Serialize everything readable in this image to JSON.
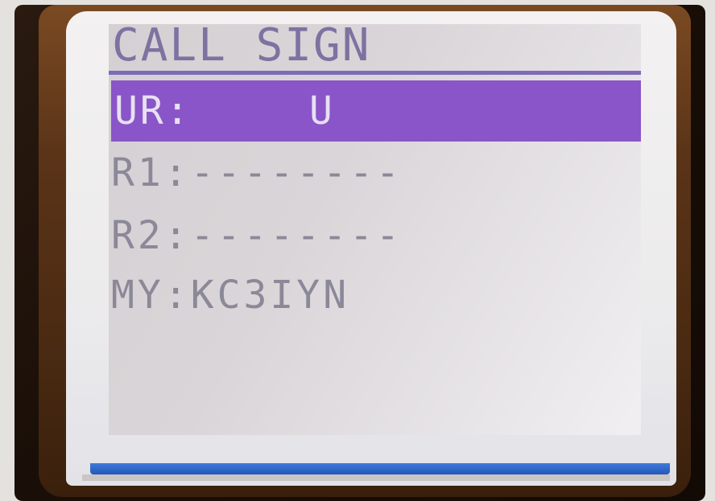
{
  "screen": {
    "title": "CALL SIGN",
    "rows": [
      {
        "label": "UR:",
        "value": "U",
        "selected": true
      },
      {
        "label": "R1:",
        "value": "--------",
        "selected": false
      },
      {
        "label": "R2:",
        "value": "--------",
        "selected": false
      },
      {
        "label": "MY:",
        "value": "KC3IYN",
        "selected": false
      }
    ]
  },
  "colors": {
    "highlight": "#8a55c8",
    "title_text": "#7c73a1",
    "row_text": "#8b8898",
    "lcd_background": "#d9d5d8",
    "status_bar": "#2c62c4"
  }
}
